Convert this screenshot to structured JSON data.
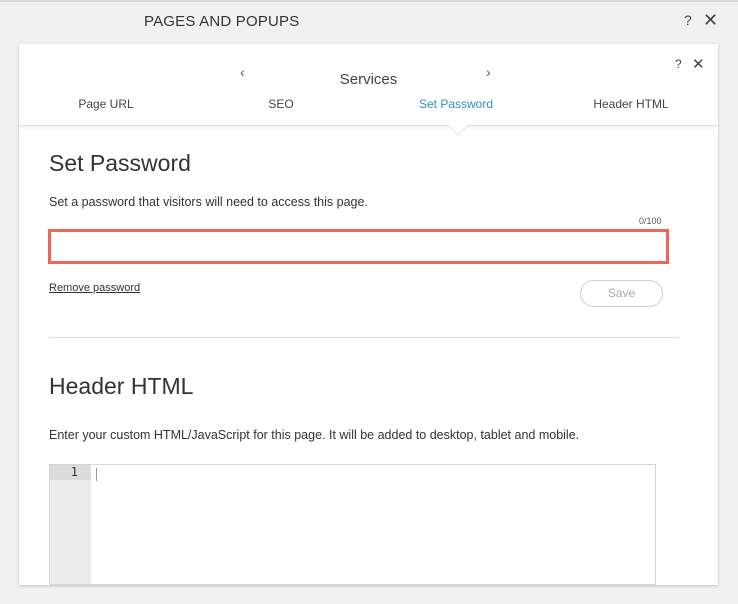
{
  "dialog": {
    "title": "PAGES AND POPUPS",
    "help": "?",
    "close": "✕"
  },
  "panel": {
    "title": "Services",
    "prev": "‹",
    "next": "›",
    "help": "?",
    "close": "✕",
    "tabs": [
      {
        "label": "Page URL",
        "active": false
      },
      {
        "label": "SEO",
        "active": false
      },
      {
        "label": "Set Password",
        "active": true
      },
      {
        "label": "Header HTML",
        "active": false
      }
    ]
  },
  "password_section": {
    "heading": "Set Password",
    "description": "Set a password that visitors will need to access this page.",
    "counter": "0/100",
    "input_value": "",
    "remove_label": "Remove password",
    "save_label": "Save"
  },
  "html_section": {
    "heading": "Header HTML",
    "description": "Enter your custom HTML/JavaScript for this page. It will be added to desktop, tablet and mobile.",
    "line_number": "1",
    "code": ""
  },
  "colors": {
    "accent": "#2f8fbf",
    "input_error_border": "#e8695c"
  }
}
